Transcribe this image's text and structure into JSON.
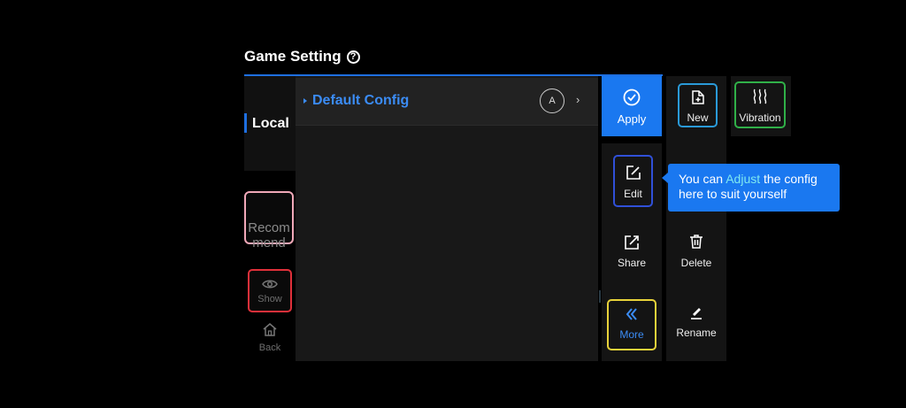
{
  "header": {
    "title": "Game Setting",
    "help_icon": "help-circle-icon"
  },
  "sidebar": {
    "local_label": "Local",
    "recommend_label": "Recom\nmend",
    "show_label": "Show",
    "back_label": "Back"
  },
  "config": {
    "name": "Default Config",
    "avatar_letter": "A",
    "chevron": "›"
  },
  "actions": {
    "apply": "Apply",
    "new": "New",
    "vibration": "Vibration",
    "edit": "Edit",
    "share": "Share",
    "delete": "Delete",
    "more": "More",
    "rename": "Rename"
  },
  "tooltip": {
    "before": "You can ",
    "highlight": "Adjust",
    "after": " the config here to suit yourself"
  },
  "colors": {
    "accent": "#1a78f0",
    "highlight": "#7ee8f0",
    "config_text": "#3b8cf5"
  }
}
